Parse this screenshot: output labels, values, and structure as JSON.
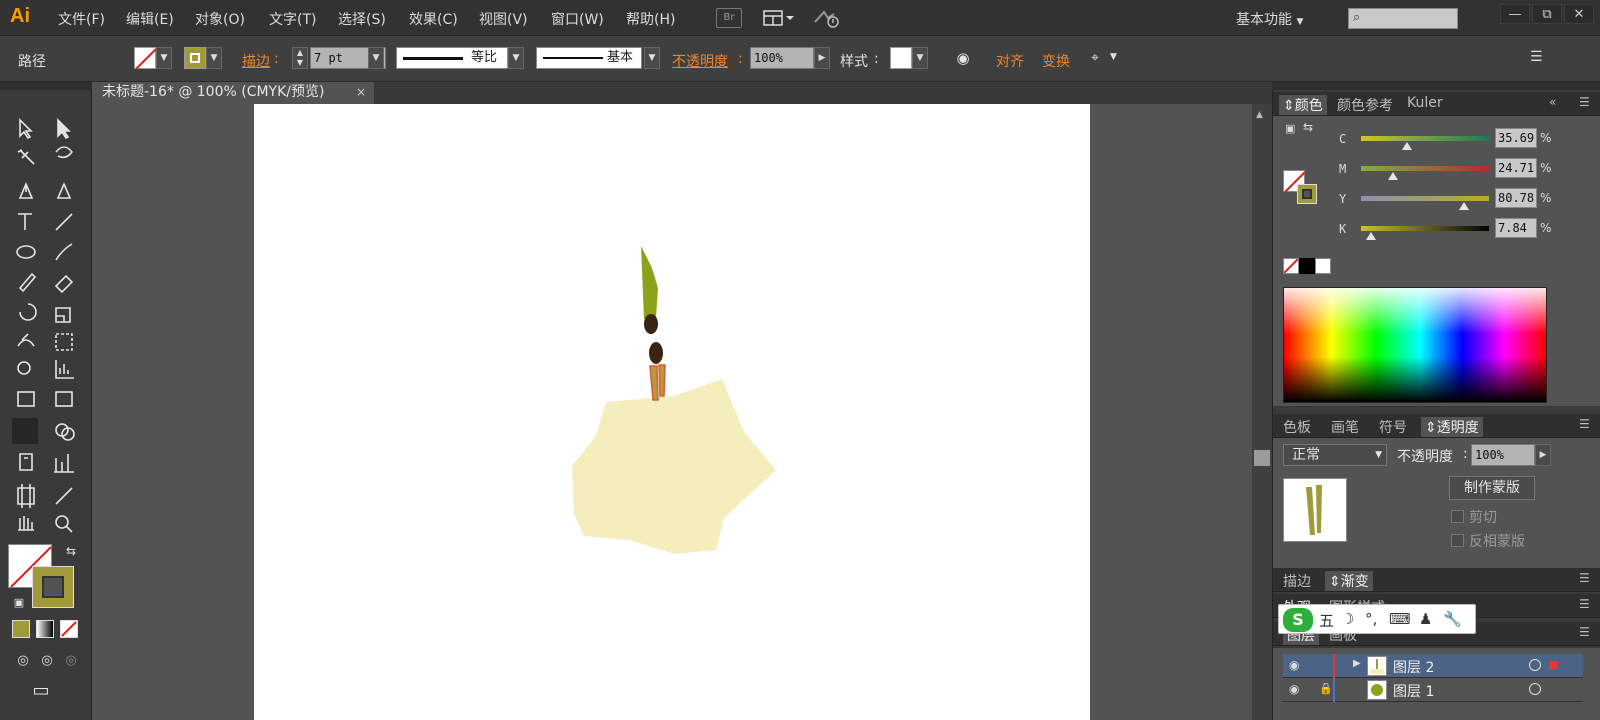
{
  "app": {
    "logo": "Ai"
  },
  "menu": [
    "文件(F)",
    "编辑(E)",
    "对象(O)",
    "文字(T)",
    "选择(S)",
    "效果(C)",
    "视图(V)",
    "窗口(W)",
    "帮助(H)"
  ],
  "toolbar_icons": {
    "bridge": "Br",
    "arrange": "arrange-documents-icon",
    "gpu": "gpu-performance-icon"
  },
  "workspace": {
    "label": "基本功能",
    "search_placeholder": ""
  },
  "window_controls": [
    "—",
    "⧉",
    "✕"
  ],
  "control_bar": {
    "selection_type": "路径",
    "stroke_label": "描边",
    "stroke_weight": "7 pt",
    "profile_label": "等比",
    "brush_label": "基本",
    "opacity_label": "不透明度",
    "opacity_value": "100%",
    "style_label": "样式",
    "align_label": "对齐",
    "transform_label": "变换",
    "colors": {
      "fill_stroke": "#a19a3a",
      "label_orange": "#f0852b"
    }
  },
  "document": {
    "tab_title": "未标题-16* @ 100% (CMYK/预览)",
    "close": "×"
  },
  "color_panel": {
    "tabs": [
      "颜色",
      "颜色参考",
      "Kuler"
    ],
    "active_tab": "颜色",
    "channels": [
      {
        "label": "C",
        "value": "35.69",
        "level": 0.357,
        "from": "#cfc33c",
        "to": "#1d7a55"
      },
      {
        "label": "M",
        "value": "24.71",
        "level": 0.247,
        "from": "#7fb33a",
        "to": "#b32b2f"
      },
      {
        "label": "Y",
        "value": "80.78",
        "level": 0.808,
        "from": "#8b8fb6",
        "to": "#b8ae2a"
      },
      {
        "label": "K",
        "value": "7.84",
        "level": 0.078,
        "from": "#c7c03d",
        "to": "#000000"
      }
    ],
    "percent_sign": "%"
  },
  "transparency_panel": {
    "tabs": [
      "色板",
      "画笔",
      "符号",
      "透明度"
    ],
    "active_tab": "透明度",
    "blend_mode": "正常",
    "opacity_label": "不透明度",
    "opacity_value": "100%",
    "make_mask": "制作蒙版",
    "clip": "剪切",
    "invert_mask": "反相蒙版"
  },
  "stroke_gradient_tabs": [
    "描边",
    "渐变"
  ],
  "appearance_tabs": [
    "外观",
    "图形样式"
  ],
  "layers_panel": {
    "tabs": [
      "图层",
      "画板"
    ],
    "layers": [
      {
        "name": "图层 2",
        "selected": true
      },
      {
        "name": "图层 1",
        "selected": false
      }
    ]
  },
  "ime": {
    "mode": "五"
  },
  "canvas_colors": {
    "leaf": "#8ca21b",
    "seed": "#3c2414",
    "body": "#f6edbc",
    "legs": "#b5993f",
    "legs_stroke": "#dc5a35"
  }
}
